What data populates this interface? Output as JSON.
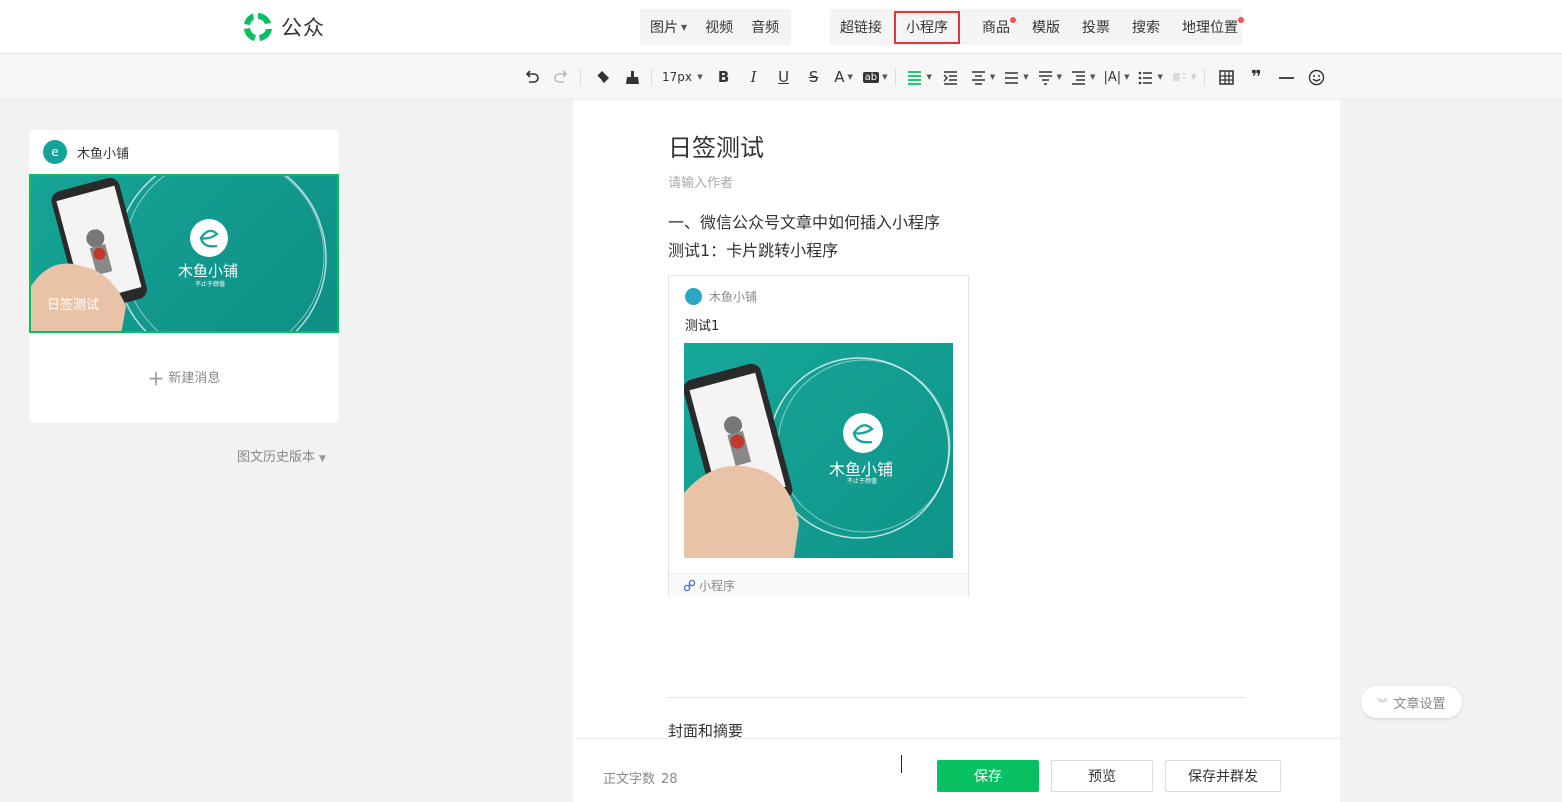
{
  "brand": {
    "logo_text": "公众"
  },
  "media_toolbar": [
    {
      "label": "图片",
      "has_caret": true
    },
    {
      "label": "视频"
    },
    {
      "label": "音频"
    }
  ],
  "insert_toolbar": [
    {
      "label": "超链接"
    },
    {
      "label": "小程序",
      "highlight": true
    },
    {
      "label": "商品",
      "dot": true
    },
    {
      "label": "模版"
    },
    {
      "label": "投票"
    },
    {
      "label": "搜索"
    },
    {
      "label": "地理位置",
      "dot": true
    }
  ],
  "format_toolbar": {
    "font_size": "17px"
  },
  "left_panel": {
    "account_name": "木鱼小铺",
    "cover_title": "日签测试",
    "new_message": "新建消息",
    "history": "图文历史版本"
  },
  "article": {
    "title": "日签测试",
    "author_placeholder": "请输入作者",
    "paragraph1": "一、微信公众号文章中如何插入小程序",
    "paragraph2": "测试1：卡片跳转小程序",
    "card": {
      "account": "木鱼小铺",
      "title": "测试1",
      "brand_big": "木鱼小铺",
      "brand_small": "不止于颜值",
      "footer": "小程序"
    },
    "cover_summary": "封面和摘要"
  },
  "bottom": {
    "word_count_label": "正文字数",
    "word_count": "28",
    "save": "保存",
    "preview": "预览",
    "publish": "保存并群发"
  },
  "settings_label": "文章设置",
  "colors": {
    "accent": "#07c160",
    "highlight_border": "#e0383e",
    "teal": "#13a39a"
  }
}
